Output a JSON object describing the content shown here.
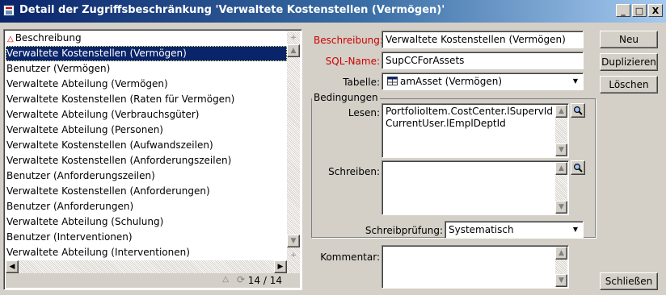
{
  "window": {
    "title": "Detail der Zugriffsbeschränkung 'Verwaltete Kostenstellen (Vermögen)'",
    "controls": [
      "_",
      "□",
      "X"
    ]
  },
  "list": {
    "header": "Beschreibung",
    "items": [
      "Verwaltete Kostenstellen (Vermögen)",
      "Benutzer (Vermögen)",
      "Verwaltete Abteilung (Vermögen)",
      "Verwaltete Kostenstellen (Raten für Vermögen)",
      "Verwaltete Abteilung (Verbrauchsgüter)",
      "Verwaltete Abteilung (Personen)",
      "Verwaltete Kostenstellen (Aufwandszeilen)",
      "Verwaltete Kostenstellen (Anforderungszeilen)",
      "Benutzer (Anforderungszeilen)",
      "Verwaltete Kostenstellen (Anforderungen)",
      "Benutzer (Anforderungen)",
      "Verwaltete Abteilung (Schulung)",
      "Benutzer (Interventionen)",
      "Verwaltete Abteilung (Interventionen)"
    ],
    "selected_index": 0,
    "count": "14 / 14"
  },
  "form": {
    "beschreibung_label": "Beschreibung:",
    "beschreibung_value": "Verwaltete Kostenstellen (Vermögen)",
    "sqlname_label": "SQL-Name:",
    "sqlname_value": "SupCCForAssets",
    "tabelle_label": "Tabelle:",
    "tabelle_value": "amAsset (Vermögen)",
    "bedingungen_label": "Bedingungen",
    "lesen_label": "Lesen:",
    "lesen_value": "PortfolioItem.CostCenter.lSupervId =\nCurrentUser.lEmplDeptId",
    "schreiben_label": "Schreiben:",
    "schreiben_value": "",
    "schreibpruefung_label": "Schreibprüfung:",
    "schreibpruefung_value": "Systematisch",
    "kommentar_label": "Kommentar:",
    "kommentar_value": ""
  },
  "buttons": {
    "neu": "Neu",
    "duplizieren": "Duplizieren",
    "loeschen": "Löschen",
    "schliessen": "Schließen"
  },
  "colors": {
    "required_label": "#cc0000",
    "selection": "#0a246a",
    "title_start": "#0a246a",
    "title_end": "#a6caf0"
  }
}
